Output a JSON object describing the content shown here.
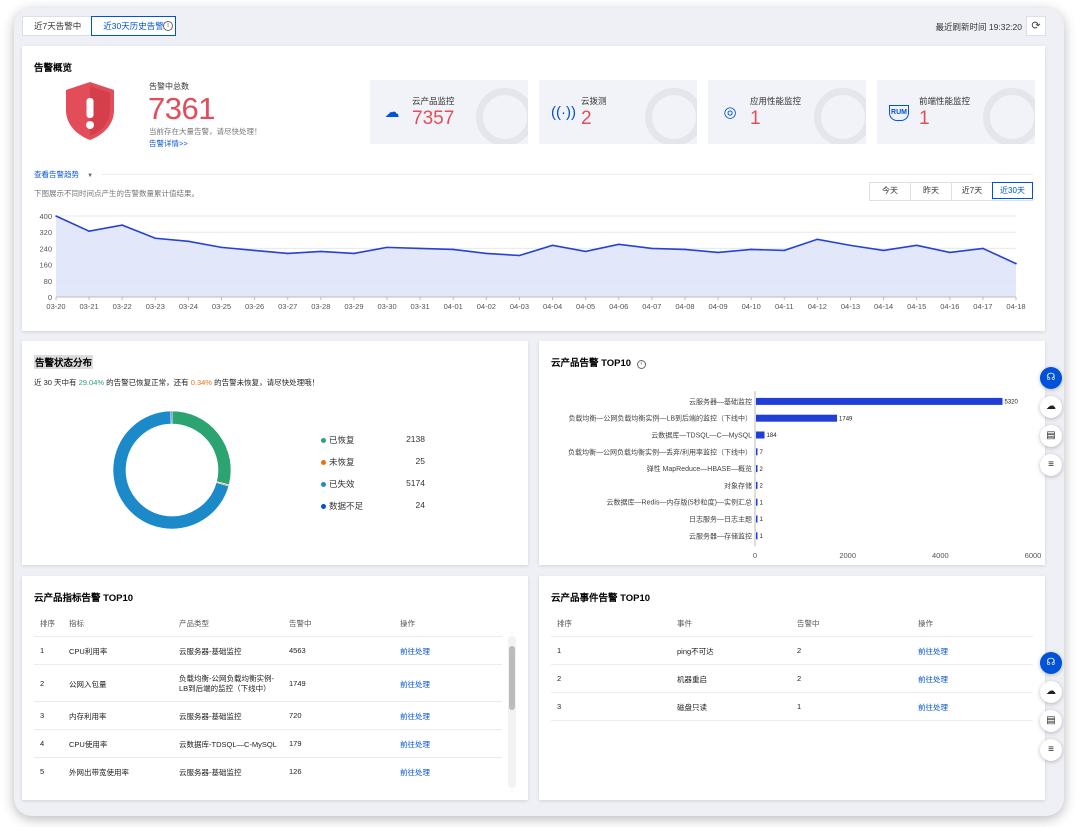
{
  "topbar": {
    "tabs": [
      "近7天告警中",
      "近30天历史告警"
    ],
    "refresh_time": "最近刷新时间 19:32:20"
  },
  "overview": {
    "title": "告警概览",
    "total_label": "告警中总数",
    "total_value": "7361",
    "warning_text": "当前存在大量告警，请尽快处理！",
    "detail_link": "告警详情>>",
    "kpis": [
      {
        "label": "云产品监控",
        "value": "7357",
        "icon": "cloud-monitor-icon"
      },
      {
        "label": "云拨测",
        "value": "2",
        "icon": "signal-icon"
      },
      {
        "label": "应用性能监控",
        "value": "1",
        "icon": "apm-icon"
      },
      {
        "label": "前端性能监控",
        "value": "1",
        "icon": "rum-icon"
      }
    ],
    "trend_toggle": "查看告警趋势",
    "trend_desc": "下图展示不同时间点产生的告警数量累计值结果。",
    "range_buttons": [
      "今天",
      "昨天",
      "近7天",
      "近30天"
    ],
    "active_range": "近30天"
  },
  "status": {
    "title": "告警状态分布",
    "summary_parts": [
      "近 30 天中有 ",
      "29.04%",
      " 的告警已恢复正常，还有 ",
      "0.34%",
      " 的告警未恢复，请尽快处理哦！"
    ],
    "legend": [
      {
        "name": "已恢复",
        "value": "2138",
        "color": "#2ba471"
      },
      {
        "name": "未恢复",
        "value": "25",
        "color": "#e37318"
      },
      {
        "name": "已失效",
        "value": "5174",
        "color": "#1c8ac9"
      },
      {
        "name": "数据不足",
        "value": "24",
        "color": "#0052d9"
      }
    ]
  },
  "top10_product": {
    "title": "云产品告警 TOP10"
  },
  "metric_table": {
    "title": "云产品指标告警 TOP10",
    "headers": [
      "排序",
      "指标",
      "产品类型",
      "告警中",
      "操作"
    ],
    "rows": [
      {
        "rank": "1",
        "metric": "CPU利用率",
        "type": "云服务器-基础监控",
        "type2": "",
        "count": "4563",
        "action": "前往处理"
      },
      {
        "rank": "2",
        "metric": "公网入包量",
        "type": "负载均衡-公网负载均衡实例-",
        "type2": "LB到后端的监控（下线中）",
        "count": "1749",
        "action": "前往处理"
      },
      {
        "rank": "3",
        "metric": "内存利用率",
        "type": "云服务器-基础监控",
        "type2": "",
        "count": "720",
        "action": "前往处理"
      },
      {
        "rank": "4",
        "metric": "CPU使用率",
        "type": "云数据库-TDSQL—C-MySQL",
        "type2": "",
        "count": "179",
        "action": "前往处理"
      },
      {
        "rank": "5",
        "metric": "外网出带宽使用率",
        "type": "云服务器-基础监控",
        "type2": "",
        "count": "126",
        "action": "前往处理"
      }
    ]
  },
  "event_table": {
    "title": "云产品事件告警 TOP10",
    "headers": [
      "排序",
      "事件",
      "告警中",
      "操作"
    ],
    "rows": [
      {
        "rank": "1",
        "event": "ping不可达",
        "count": "2",
        "action": "前往处理"
      },
      {
        "rank": "2",
        "event": "机器重启",
        "count": "2",
        "action": "前往处理"
      },
      {
        "rank": "3",
        "event": "磁盘只读",
        "count": "1",
        "action": "前往处理"
      }
    ]
  },
  "chart_data": [
    {
      "type": "area",
      "x": [
        "03-20",
        "03-21",
        "03-22",
        "03-23",
        "03-24",
        "03-25",
        "03-26",
        "03-27",
        "03-28",
        "03-29",
        "03-30",
        "03-31",
        "04-01",
        "04-02",
        "04-03",
        "04-04",
        "04-05",
        "04-06",
        "04-07",
        "04-08",
        "04-09",
        "04-10",
        "04-11",
        "04-12",
        "04-13",
        "04-14",
        "04-15",
        "04-16",
        "04-17",
        "04-18"
      ],
      "y": [
        400,
        325,
        355,
        290,
        275,
        245,
        230,
        215,
        225,
        215,
        245,
        240,
        235,
        215,
        205,
        255,
        225,
        260,
        240,
        235,
        220,
        235,
        230,
        285,
        255,
        230,
        255,
        220,
        240,
        165
      ],
      "yticks": [
        0,
        80,
        160,
        240,
        320,
        400
      ],
      "ylim": [
        0,
        400
      ],
      "color": "#2541d6",
      "grid": true
    },
    {
      "type": "pie",
      "labels": [
        "已恢复",
        "未恢复",
        "已失效",
        "数据不足"
      ],
      "values": [
        2138,
        25,
        5174,
        24
      ],
      "colors": [
        "#2ba471",
        "#e37318",
        "#1c8ac9",
        "#0052d9"
      ],
      "donut": true
    },
    {
      "type": "bar",
      "orientation": "horizontal",
      "categories": [
        "云服务器—基础监控",
        "负载均衡—公网负载均衡实例—LB到后端的监控（下线中）",
        "云数据库—TDSQL—C—MySQL",
        "负载均衡—公网负载均衡实例—丢弃/利用率监控（下线中）",
        "弹性 MapReduce—HBASE—概览",
        "对象存储",
        "云数据库—Redis—内存版(5秒粒度)—实例汇总",
        "日志服务—日志主题",
        "云服务器—存储监控"
      ],
      "values": [
        5320,
        1749,
        184,
        7,
        2,
        2,
        1,
        1,
        1
      ],
      "xticks": [
        0,
        2000,
        4000,
        6000
      ],
      "xlim": [
        0,
        6000
      ],
      "color": "#1f3fd6"
    }
  ]
}
